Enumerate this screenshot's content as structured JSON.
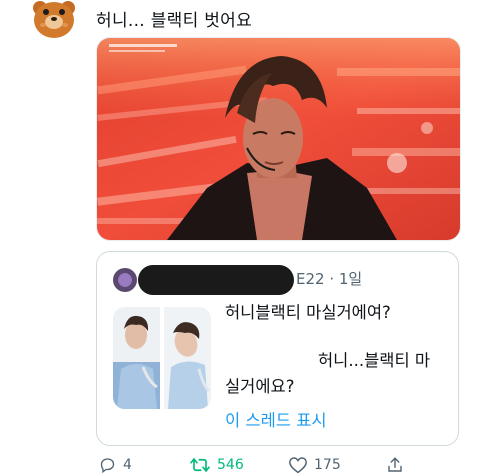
{
  "tweet": {
    "text": "허니... 블랙티 벗어요"
  },
  "quote": {
    "meta": "E22 · 1일",
    "line1": "허니블랙티 마실거에여?",
    "line2": "허니...블랙티 마",
    "line3": "실거에요?",
    "show_thread": "이 스레드 표시"
  },
  "actions": {
    "replies": "4",
    "retweets": "546",
    "likes": "175"
  },
  "colors": {
    "accent": "#1d9bf0",
    "retweet": "#00ba7c",
    "muted": "#536471"
  }
}
